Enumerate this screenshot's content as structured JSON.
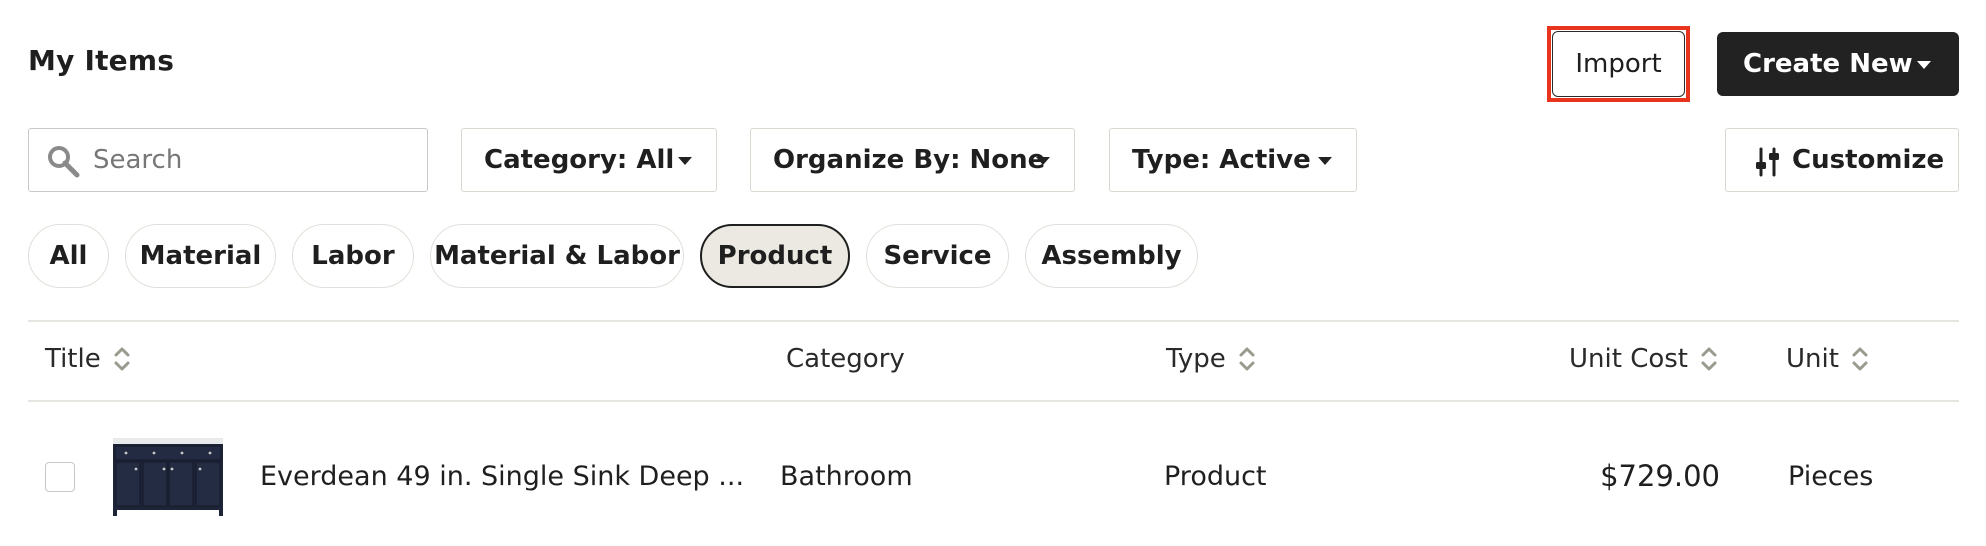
{
  "header": {
    "title": "My Items",
    "import_label": "Import",
    "create_label": "Create New"
  },
  "toolbar": {
    "search_placeholder": "Search",
    "filters": [
      {
        "label": "Category: All"
      },
      {
        "label": "Organize By: None"
      },
      {
        "label": "Type: Active"
      }
    ],
    "customize_label": "Customize"
  },
  "chips": [
    {
      "label": "All",
      "active": false
    },
    {
      "label": "Material",
      "active": false
    },
    {
      "label": "Labor",
      "active": false
    },
    {
      "label": "Material & Labor",
      "active": false
    },
    {
      "label": "Product",
      "active": true
    },
    {
      "label": "Service",
      "active": false
    },
    {
      "label": "Assembly",
      "active": false
    }
  ],
  "table": {
    "columns": [
      {
        "label": "Title",
        "sortable": true
      },
      {
        "label": "Category",
        "sortable": false
      },
      {
        "label": "Type",
        "sortable": true
      },
      {
        "label": "Unit Cost",
        "sortable": true
      },
      {
        "label": "Unit",
        "sortable": true
      }
    ],
    "rows": [
      {
        "title": "Everdean 49 in. Single Sink Deep ...",
        "category": "Bathroom",
        "type": "Product",
        "unit_cost": "$729.00",
        "unit": "Pieces",
        "checked": false,
        "thumbnail": "navy-vanity-image"
      }
    ]
  },
  "colors": {
    "accent_dark": "#222222",
    "highlight_red": "#e8341c",
    "chip_active_bg": "#ebe9e1",
    "sort_icon": "#9a9a8e"
  },
  "icons": {
    "search": "search-icon",
    "caret": "caret-down-icon",
    "customize": "sliders-icon",
    "sort": "sort-icon"
  }
}
